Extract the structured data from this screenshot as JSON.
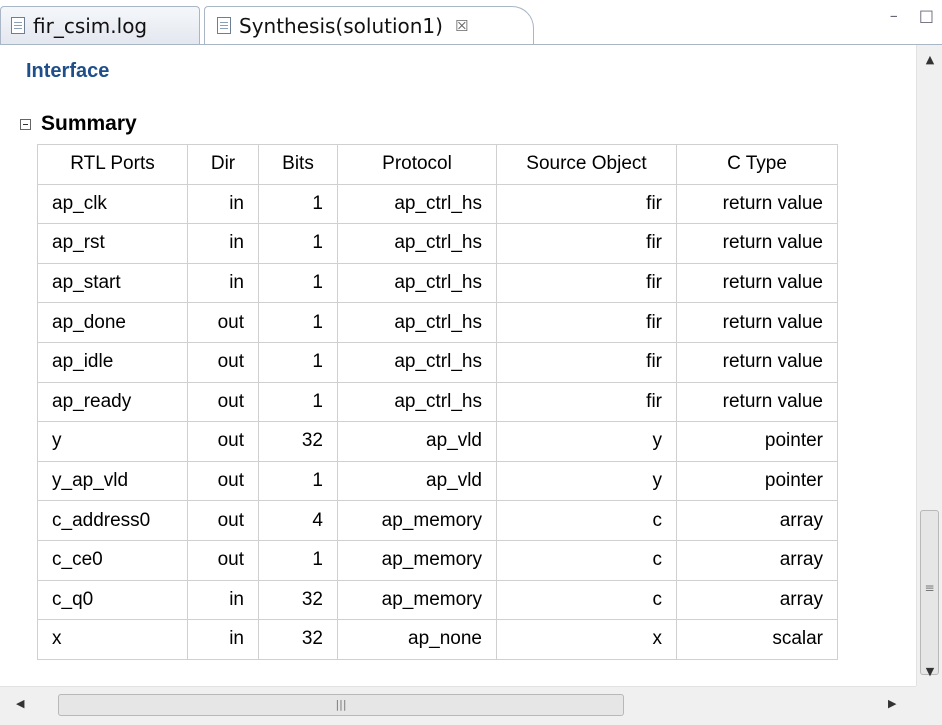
{
  "tabs": [
    {
      "label": "fir_csim.log",
      "icon": "log-file-icon"
    },
    {
      "label": "Synthesis(solution1)",
      "icon": "report-file-icon",
      "close_glyph": "☒"
    }
  ],
  "window_controls": {
    "minimize": "–",
    "maximize": "□"
  },
  "section_title": "Interface",
  "summary": {
    "toggle_glyph": "⊟",
    "label": "Summary",
    "headers": [
      "RTL Ports",
      "Dir",
      "Bits",
      "Protocol",
      "Source Object",
      "C Type"
    ],
    "rows": [
      [
        "ap_clk",
        "in",
        "1",
        "ap_ctrl_hs",
        "fir",
        "return value"
      ],
      [
        "ap_rst",
        "in",
        "1",
        "ap_ctrl_hs",
        "fir",
        "return value"
      ],
      [
        "ap_start",
        "in",
        "1",
        "ap_ctrl_hs",
        "fir",
        "return value"
      ],
      [
        "ap_done",
        "out",
        "1",
        "ap_ctrl_hs",
        "fir",
        "return value"
      ],
      [
        "ap_idle",
        "out",
        "1",
        "ap_ctrl_hs",
        "fir",
        "return value"
      ],
      [
        "ap_ready",
        "out",
        "1",
        "ap_ctrl_hs",
        "fir",
        "return value"
      ],
      [
        "y",
        "out",
        "32",
        "ap_vld",
        "y",
        "pointer"
      ],
      [
        "y_ap_vld",
        "out",
        "1",
        "ap_vld",
        "y",
        "pointer"
      ],
      [
        "c_address0",
        "out",
        "4",
        "ap_memory",
        "c",
        "array"
      ],
      [
        "c_ce0",
        "out",
        "1",
        "ap_memory",
        "c",
        "array"
      ],
      [
        "c_q0",
        "in",
        "32",
        "ap_memory",
        "c",
        "array"
      ],
      [
        "x",
        "in",
        "32",
        "ap_none",
        "x",
        "scalar"
      ]
    ]
  },
  "scrollbars": {
    "up_arrow": "▲",
    "down_arrow": "▼",
    "left_arrow": "◀",
    "right_arrow": "▶",
    "grip": "|||"
  }
}
